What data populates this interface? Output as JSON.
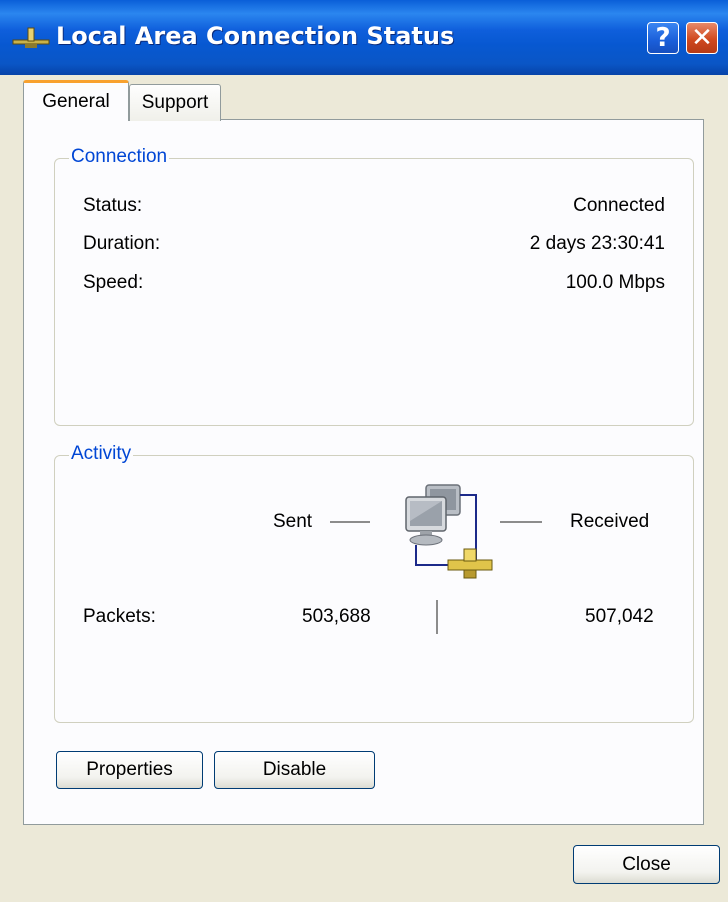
{
  "window": {
    "title": "Local Area Connection Status",
    "help_label": "?",
    "close_label": "✕"
  },
  "tabs": [
    {
      "label": "General",
      "active": true
    },
    {
      "label": "Support",
      "active": false
    }
  ],
  "connection": {
    "legend": "Connection",
    "rows": [
      {
        "label": "Status:",
        "value": "Connected"
      },
      {
        "label": "Duration:",
        "value": "2 days 23:30:41"
      },
      {
        "label": "Speed:",
        "value": "100.0 Mbps"
      }
    ]
  },
  "activity": {
    "legend": "Activity",
    "sent_label": "Sent",
    "received_label": "Received",
    "packets_label": "Packets:",
    "packets_sent": "503,688",
    "packets_received": "507,042",
    "icon": "network-computers-icon"
  },
  "buttons": {
    "properties": "Properties",
    "disable": "Disable",
    "close": "Close"
  },
  "colors": {
    "titlebar": "#0a5fd8",
    "group_legend": "#0046d5",
    "active_tab_accent": "#f8a12e",
    "dialog_background": "#ece9d8"
  }
}
